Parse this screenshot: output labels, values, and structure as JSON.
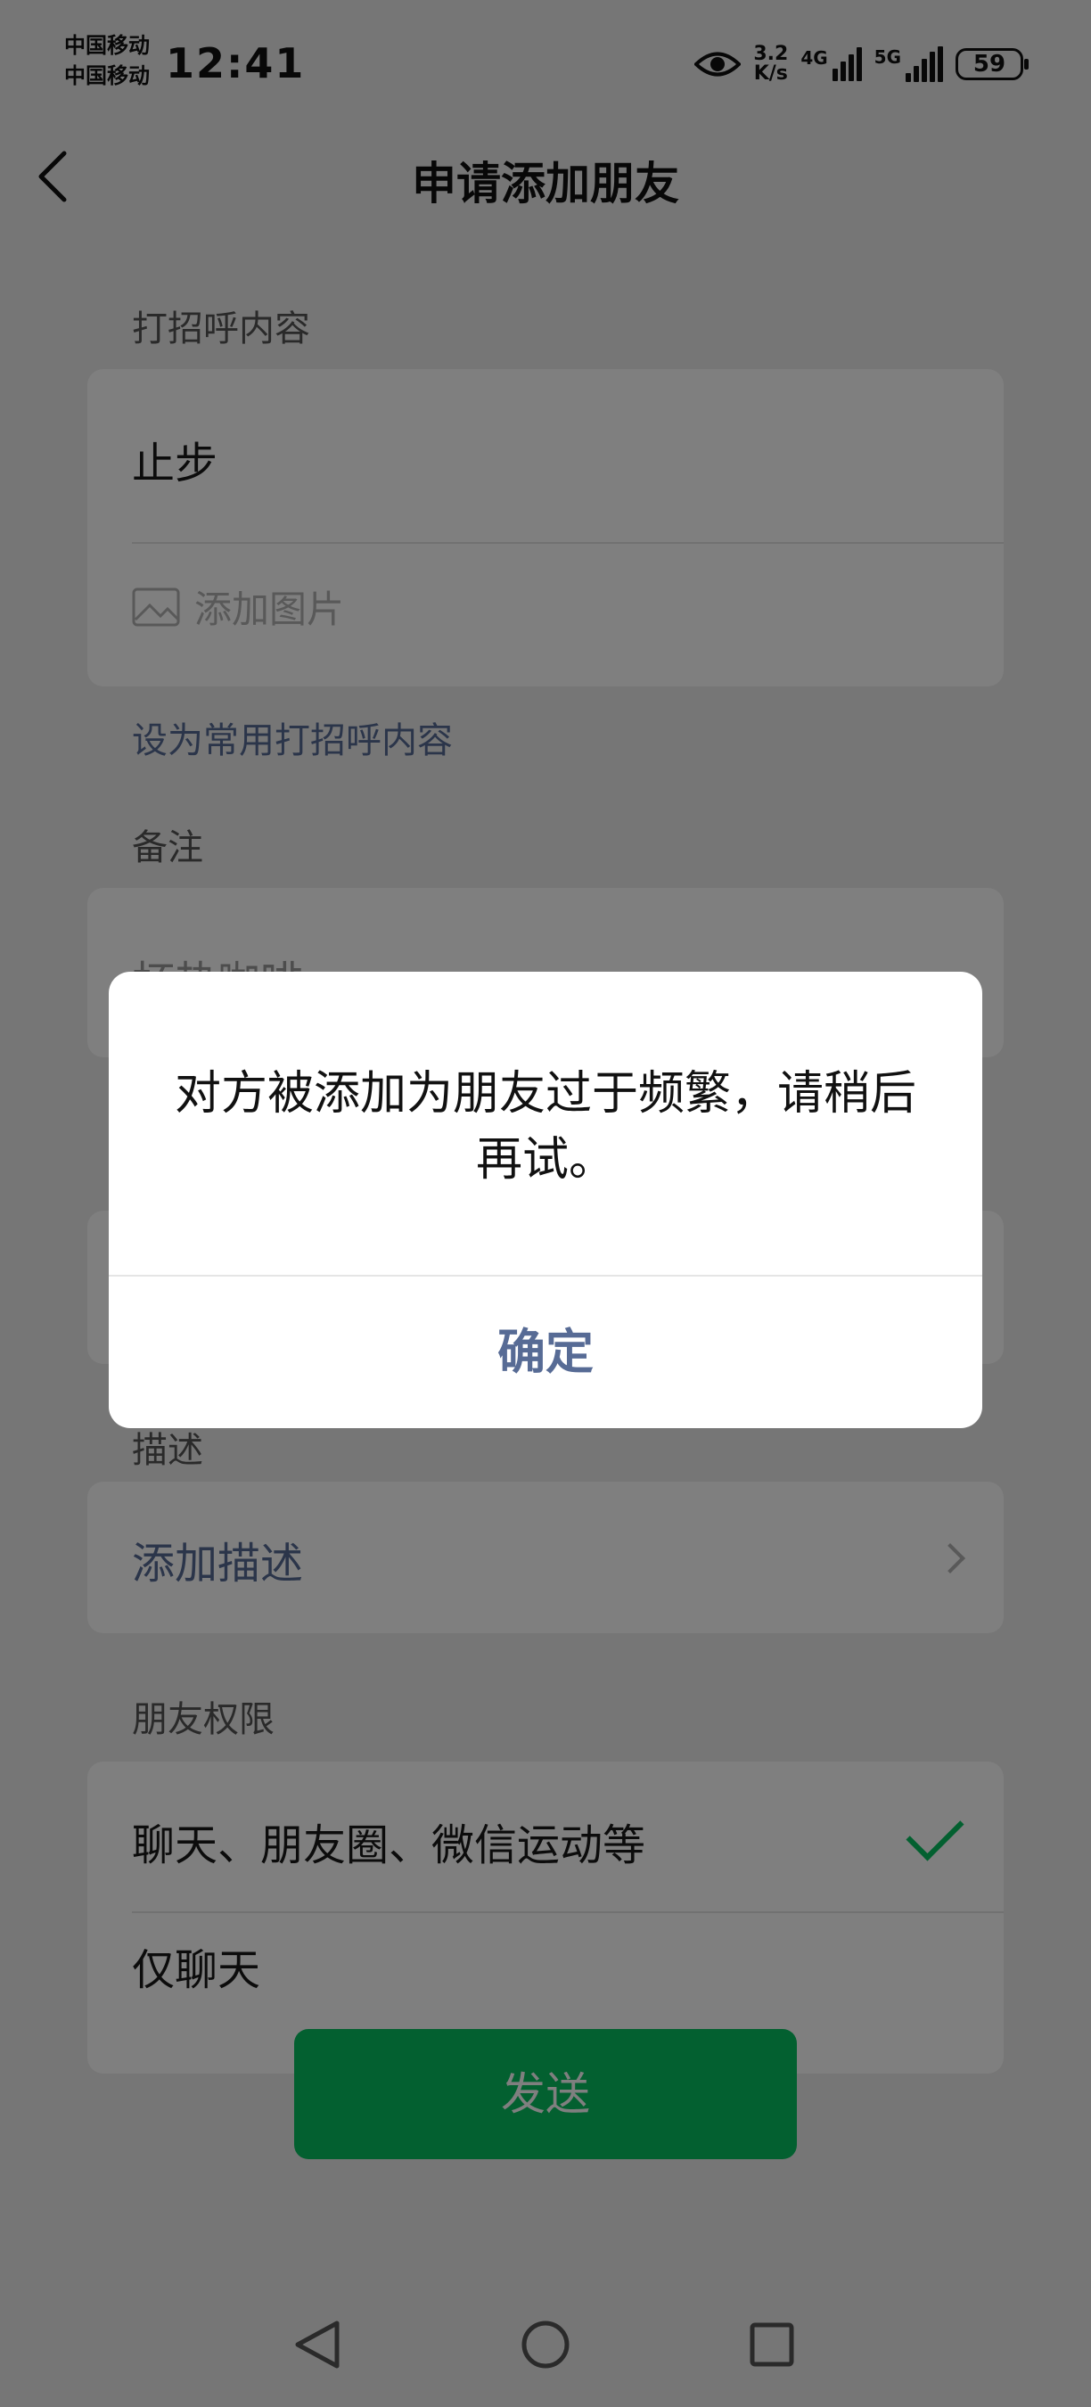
{
  "status_bar": {
    "carrier1": "中国移动",
    "carrier2": "中国移动",
    "time": "12:41",
    "speed_value": "3.2",
    "speed_unit": "K/s",
    "net1": "4G",
    "net2": "5G",
    "battery": "59",
    "eye_icon": "eye-icon"
  },
  "header": {
    "title": "申请添加朋友",
    "back_icon": "chevron-left-icon"
  },
  "greeting": {
    "label": "打招呼内容",
    "text": "止步",
    "add_image": "添加图片",
    "image_icon": "image-icon",
    "set_common": "设为常用打招呼内容"
  },
  "remark": {
    "label": "备注",
    "value": "杯热咖啡"
  },
  "description": {
    "label": "描述",
    "add": "添加描述"
  },
  "permission": {
    "label": "朋友权限",
    "option1": "聊天、朋友圈、微信运动等",
    "option2": "仅聊天"
  },
  "send_button": "发送",
  "dialog": {
    "message": "对方被添加为朋友过于频繁，请稍后再试。",
    "confirm": "确定"
  },
  "colors": {
    "accent": "#07c160",
    "link": "#576b95",
    "background": "#ededed"
  }
}
